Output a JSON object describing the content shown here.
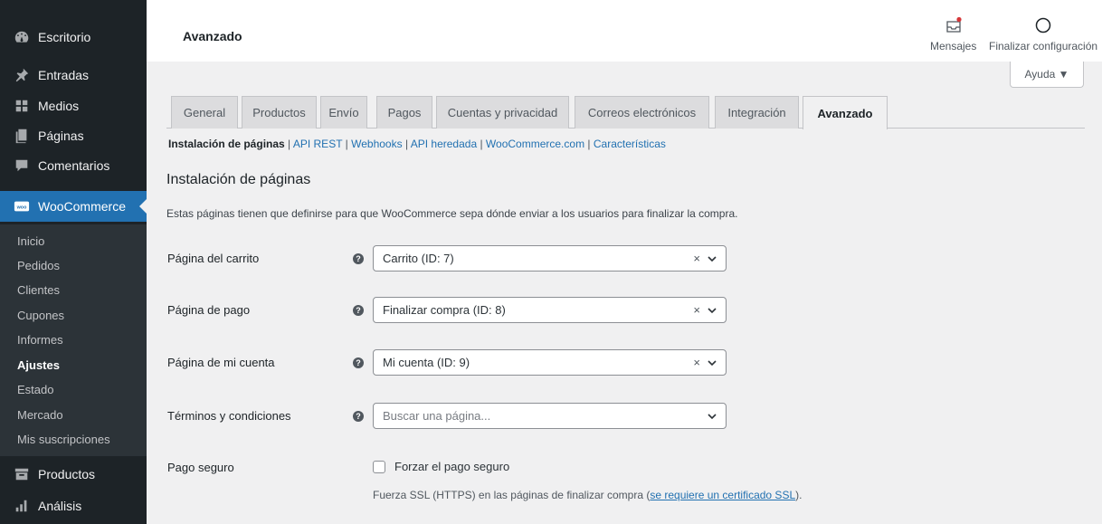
{
  "sidebar": {
    "items": [
      {
        "label": "Escritorio",
        "icon": "dashboard-icon"
      },
      {
        "label": "Entradas",
        "icon": "pin-icon"
      },
      {
        "label": "Medios",
        "icon": "media-icon"
      },
      {
        "label": "Páginas",
        "icon": "pages-icon"
      },
      {
        "label": "Comentarios",
        "icon": "comments-icon"
      },
      {
        "label": "WooCommerce",
        "icon": "woocommerce-icon"
      },
      {
        "label": "Productos",
        "icon": "archive-icon"
      },
      {
        "label": "Análisis",
        "icon": "chart-bar-icon"
      }
    ],
    "submenu": [
      "Inicio",
      "Pedidos",
      "Clientes",
      "Cupones",
      "Informes",
      "Ajustes",
      "Estado",
      "Mercado",
      "Mis suscripciones"
    ],
    "active_submenu": "Ajustes"
  },
  "header": {
    "title": "Avanzado",
    "messages_label": "Mensajes",
    "setup_label": "Finalizar configuración"
  },
  "help_label": "Ayuda ▼",
  "tabs": [
    "General",
    "Productos",
    "Envío",
    "Pagos",
    "Cuentas y privacidad",
    "Correos electrónicos",
    "Integración",
    "Avanzado"
  ],
  "active_tab": "Avanzado",
  "subnav": {
    "current": "Instalación de páginas",
    "links": [
      "API REST",
      "Webhooks",
      "API heredada",
      "WooCommerce.com",
      "Características"
    ]
  },
  "section": {
    "title": "Instalación de páginas",
    "description": "Estas páginas tienen que definirse para que WooCommerce sepa dónde enviar a los usuarios para finalizar la compra."
  },
  "fields": {
    "cart": {
      "label": "Página del carrito",
      "value": "Carrito (ID: 7)"
    },
    "checkout": {
      "label": "Página de pago",
      "value": "Finalizar compra (ID: 8)"
    },
    "myaccount": {
      "label": "Página de mi cuenta",
      "value": "Mi cuenta (ID: 9)"
    },
    "terms": {
      "label": "Términos y condiciones",
      "placeholder": "Buscar una página..."
    },
    "secure": {
      "label": "Pago seguro",
      "checkbox_label": "Forzar el pago seguro",
      "checked": false,
      "desc_before": "Fuerza SSL (HTTPS) en las páginas de finalizar compra (",
      "desc_link": "se requiere un certificado SSL",
      "desc_after": ")."
    }
  },
  "help_tip_glyph": "?",
  "clear_glyph": "×",
  "colors": {
    "accent": "#2271b1",
    "sidebar": "#1d2327",
    "notification": "#d63638"
  }
}
